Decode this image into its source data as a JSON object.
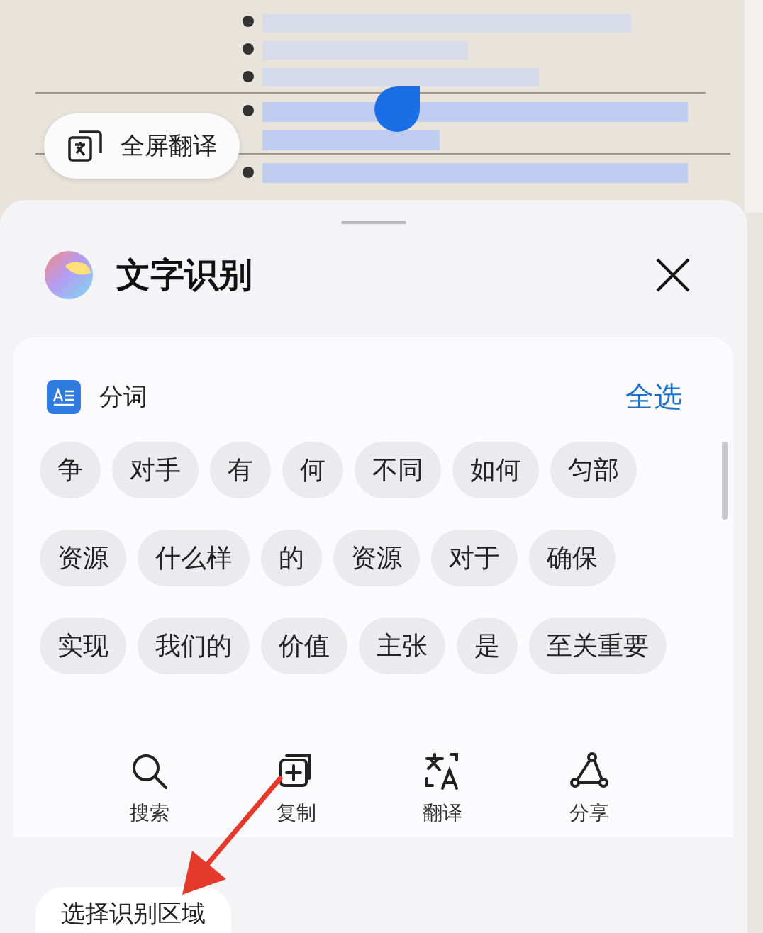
{
  "fullscreen_translate": {
    "label": "全屏翻译"
  },
  "sheet": {
    "title": "文字识别"
  },
  "segment_panel": {
    "label": "分词",
    "select_all": "全选",
    "chip_rows": [
      [
        "争",
        "对手",
        "有",
        "何",
        "不同",
        "如何",
        "匀部"
      ],
      [
        "资源",
        "什么样",
        "的",
        "资源",
        "对于",
        "确保"
      ],
      [
        "实现",
        "我们的",
        "价值",
        "主张",
        "是",
        "至关重要"
      ]
    ]
  },
  "actions": [
    {
      "kind": "search",
      "label": "搜索"
    },
    {
      "kind": "copy",
      "label": "复制"
    },
    {
      "kind": "translate",
      "label": "翻译"
    },
    {
      "kind": "share",
      "label": "分享"
    }
  ],
  "select_region": {
    "label": "选择识别区域"
  }
}
